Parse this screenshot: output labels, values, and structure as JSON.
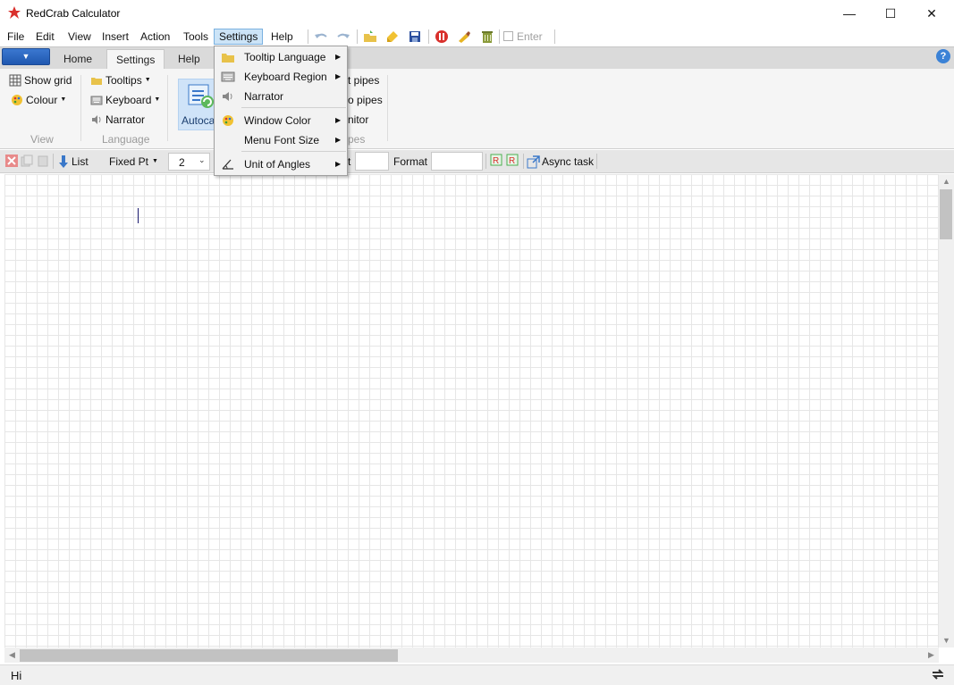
{
  "window": {
    "title": "RedCrab Calculator",
    "controls": {
      "minimize": "—",
      "maximize": "☐",
      "close": "✕"
    }
  },
  "menubar": {
    "items": [
      "File",
      "Edit",
      "View",
      "Insert",
      "Action",
      "Tools",
      "Settings",
      "Help"
    ],
    "active": "Settings",
    "toolbar": {
      "icons": [
        "undo-icon",
        "redo-icon",
        "open-folder-icon",
        "new-file-icon",
        "save-icon",
        "stop-icon",
        "clear-icon",
        "trash-icon"
      ],
      "enter_label": "Enter"
    }
  },
  "ribbon": {
    "app_button": "▼",
    "tabs": [
      "Home",
      "Settings",
      "Help"
    ],
    "active_tab": "Settings",
    "help_icon": "?",
    "groups": {
      "view": {
        "label": "View",
        "show_grid": "Show grid",
        "colour": "Colour"
      },
      "language": {
        "label": "Language",
        "tooltips": "Tooltips",
        "keyboard": "Keyboard",
        "narrator": "Narrator"
      },
      "autocalc": {
        "label_partial": "Autoca"
      },
      "pipes": {
        "label_partial": "pes",
        "item1": "t pipes",
        "item2": "o pipes",
        "item3": "nitor"
      }
    }
  },
  "formatbar": {
    "list_label": "List",
    "number_format": "Fixed Pt",
    "decimals": "2",
    "partial_label": "t",
    "format_label": "Format",
    "async_label": "Async task"
  },
  "dropdown": {
    "items": [
      {
        "label": "Tooltip Language",
        "icon": "folder-icon",
        "submenu": true
      },
      {
        "label": "Keyboard Region",
        "icon": "keyboard-icon",
        "submenu": true
      },
      {
        "label": "Narrator",
        "icon": "speaker-icon",
        "submenu": false
      },
      {
        "label": "Window Color",
        "icon": "palette-icon",
        "submenu": true
      },
      {
        "label": "Menu Font Size",
        "icon": "",
        "submenu": true
      },
      {
        "label": "Unit of Angles",
        "icon": "angle-icon",
        "submenu": true
      }
    ]
  },
  "statusbar": {
    "text": "Hi"
  },
  "colors": {
    "accent": "#cce4f7",
    "app_button": "#2a65c0",
    "grid_line": "#e6e6e6"
  }
}
